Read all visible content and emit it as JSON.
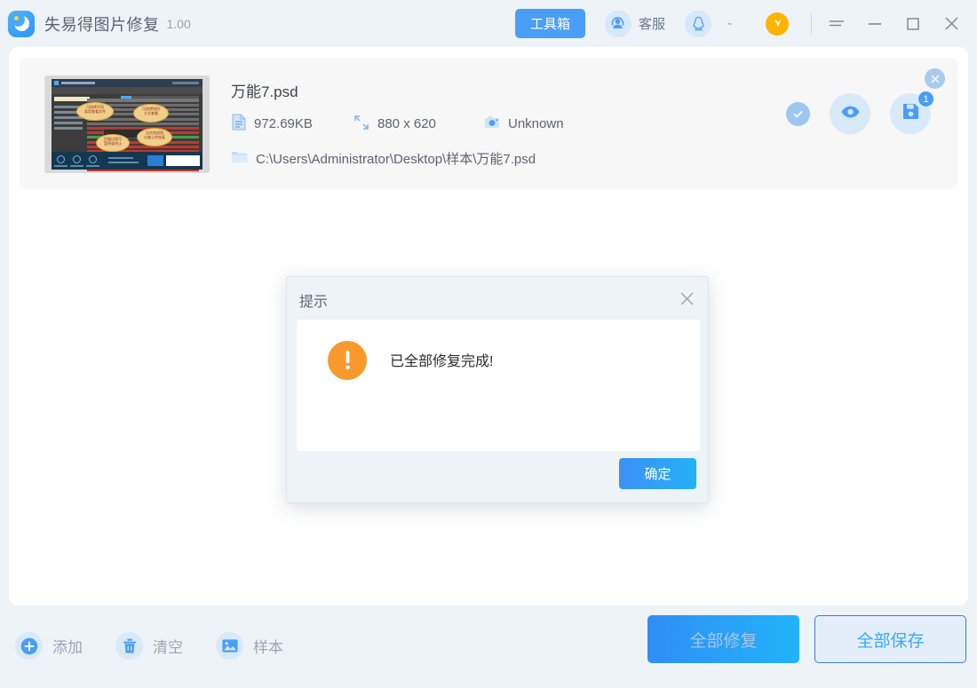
{
  "titlebar": {
    "app_name": "失易得图片修复",
    "version": "1.00",
    "logo_icon": "app-logo-icon",
    "toolbox_label": "工具箱",
    "service_label": "客服",
    "service_icon": "headset-avatar-icon",
    "qq_icon": "qq-penguin-icon",
    "qq_value": "-",
    "yellow_icon": "yellow-badge-icon",
    "menu_icon": "menu-icon",
    "minimize_icon": "minimize-icon",
    "maximize_icon": "maximize-icon",
    "close_icon": "close-icon"
  },
  "file_card": {
    "thumbnail_icon": "file-thumbnail",
    "file_name": "万能7.psd",
    "size_icon": "document-icon",
    "size": "972.69KB",
    "dimension_icon": "resize-arrows-icon",
    "dimensions": "880 x 620",
    "camera_icon": "camera-icon",
    "camera_model": "Unknown",
    "folder_icon": "folder-icon",
    "path": "C:\\Users\\Administrator\\Desktop\\样本\\万能7.psd",
    "status_icon": "check-circle-icon",
    "preview_icon": "eye-icon",
    "save_icon": "floppy-disk-icon",
    "save_badge": "1",
    "remove_icon": "close-circle-icon"
  },
  "dialog": {
    "title": "提示",
    "close_icon": "close-icon",
    "alert_icon": "exclamation-circle-icon",
    "message": "已全部修复完成!",
    "confirm_label": "确定"
  },
  "bottom": {
    "add_icon": "plus-circle-icon",
    "add_label": "添加",
    "clear_icon": "trash-icon",
    "clear_label": "清空",
    "sample_icon": "image-icon",
    "sample_label": "样本",
    "repair_all_label": "全部修复",
    "save_all_label": "全部保存"
  },
  "colors": {
    "accent": "#4a9ef5",
    "accent_light": "#d8e9f8",
    "window_bg": "#eef3f8",
    "panel_bg": "#ffffff",
    "card_bg": "#f7f7f7",
    "alert_orange": "#f79a2b",
    "save_border": "#3d7fc6"
  }
}
